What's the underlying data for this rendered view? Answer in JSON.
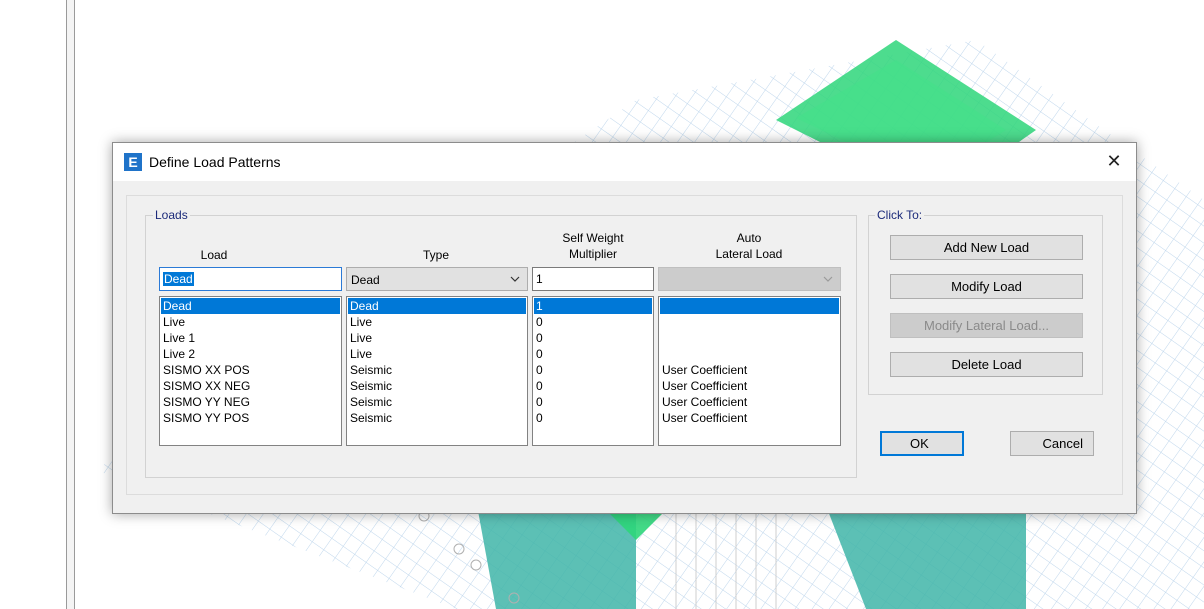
{
  "dialog": {
    "title": "Define Load Patterns",
    "icon_letter": "E",
    "close_glyph": "✕"
  },
  "loads_group": {
    "legend": "Loads",
    "columns": {
      "load": "Load",
      "type": "Type",
      "self_weight_line1": "Self Weight",
      "self_weight_line2": "Multiplier",
      "auto_line1": "Auto",
      "auto_line2": "Lateral Load"
    },
    "edit": {
      "load_value": "Dead",
      "type_value": "Dead",
      "multiplier_value": "1",
      "auto_value": ""
    },
    "rows": [
      {
        "load": "Dead",
        "type": "Dead",
        "multiplier": "1",
        "auto": ""
      },
      {
        "load": "Live",
        "type": "Live",
        "multiplier": "0",
        "auto": ""
      },
      {
        "load": "Live 1",
        "type": "Live",
        "multiplier": "0",
        "auto": ""
      },
      {
        "load": "Live 2",
        "type": "Live",
        "multiplier": "0",
        "auto": ""
      },
      {
        "load": "SISMO XX POS",
        "type": "Seismic",
        "multiplier": "0",
        "auto": "User Coefficient"
      },
      {
        "load": "SISMO XX NEG",
        "type": "Seismic",
        "multiplier": "0",
        "auto": "User Coefficient"
      },
      {
        "load": "SISMO YY NEG",
        "type": "Seismic",
        "multiplier": "0",
        "auto": "User Coefficient"
      },
      {
        "load": "SISMO YY POS",
        "type": "Seismic",
        "multiplier": "0",
        "auto": "User Coefficient"
      }
    ],
    "selected_row": 0
  },
  "click_to_group": {
    "legend": "Click To:",
    "add_new_load": "Add New Load",
    "modify_load": "Modify Load",
    "modify_lateral_load": "Modify Lateral Load...",
    "delete_load": "Delete Load"
  },
  "buttons": {
    "ok": "OK",
    "cancel": "Cancel"
  },
  "icons": {
    "dropdown": "chevron-down-icon",
    "app": "etabs-app-icon",
    "close": "close-icon"
  },
  "colors": {
    "selection": "#0078d7",
    "legend_text": "#1b2a7a",
    "model_green": "#2ed67a",
    "model_teal": "#3fb5a8"
  }
}
